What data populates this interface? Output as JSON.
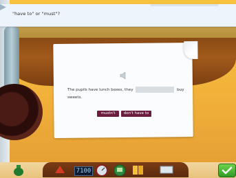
{
  "header": {
    "title": "\"have to\" or \"must\"?"
  },
  "exercise": {
    "sentence_start": "The pupils have lunch boxes, they",
    "sentence_end": "buy sweets.",
    "options": [
      "mustn't",
      "don't have to"
    ]
  },
  "toolbar": {
    "counter_value": "7100"
  }
}
